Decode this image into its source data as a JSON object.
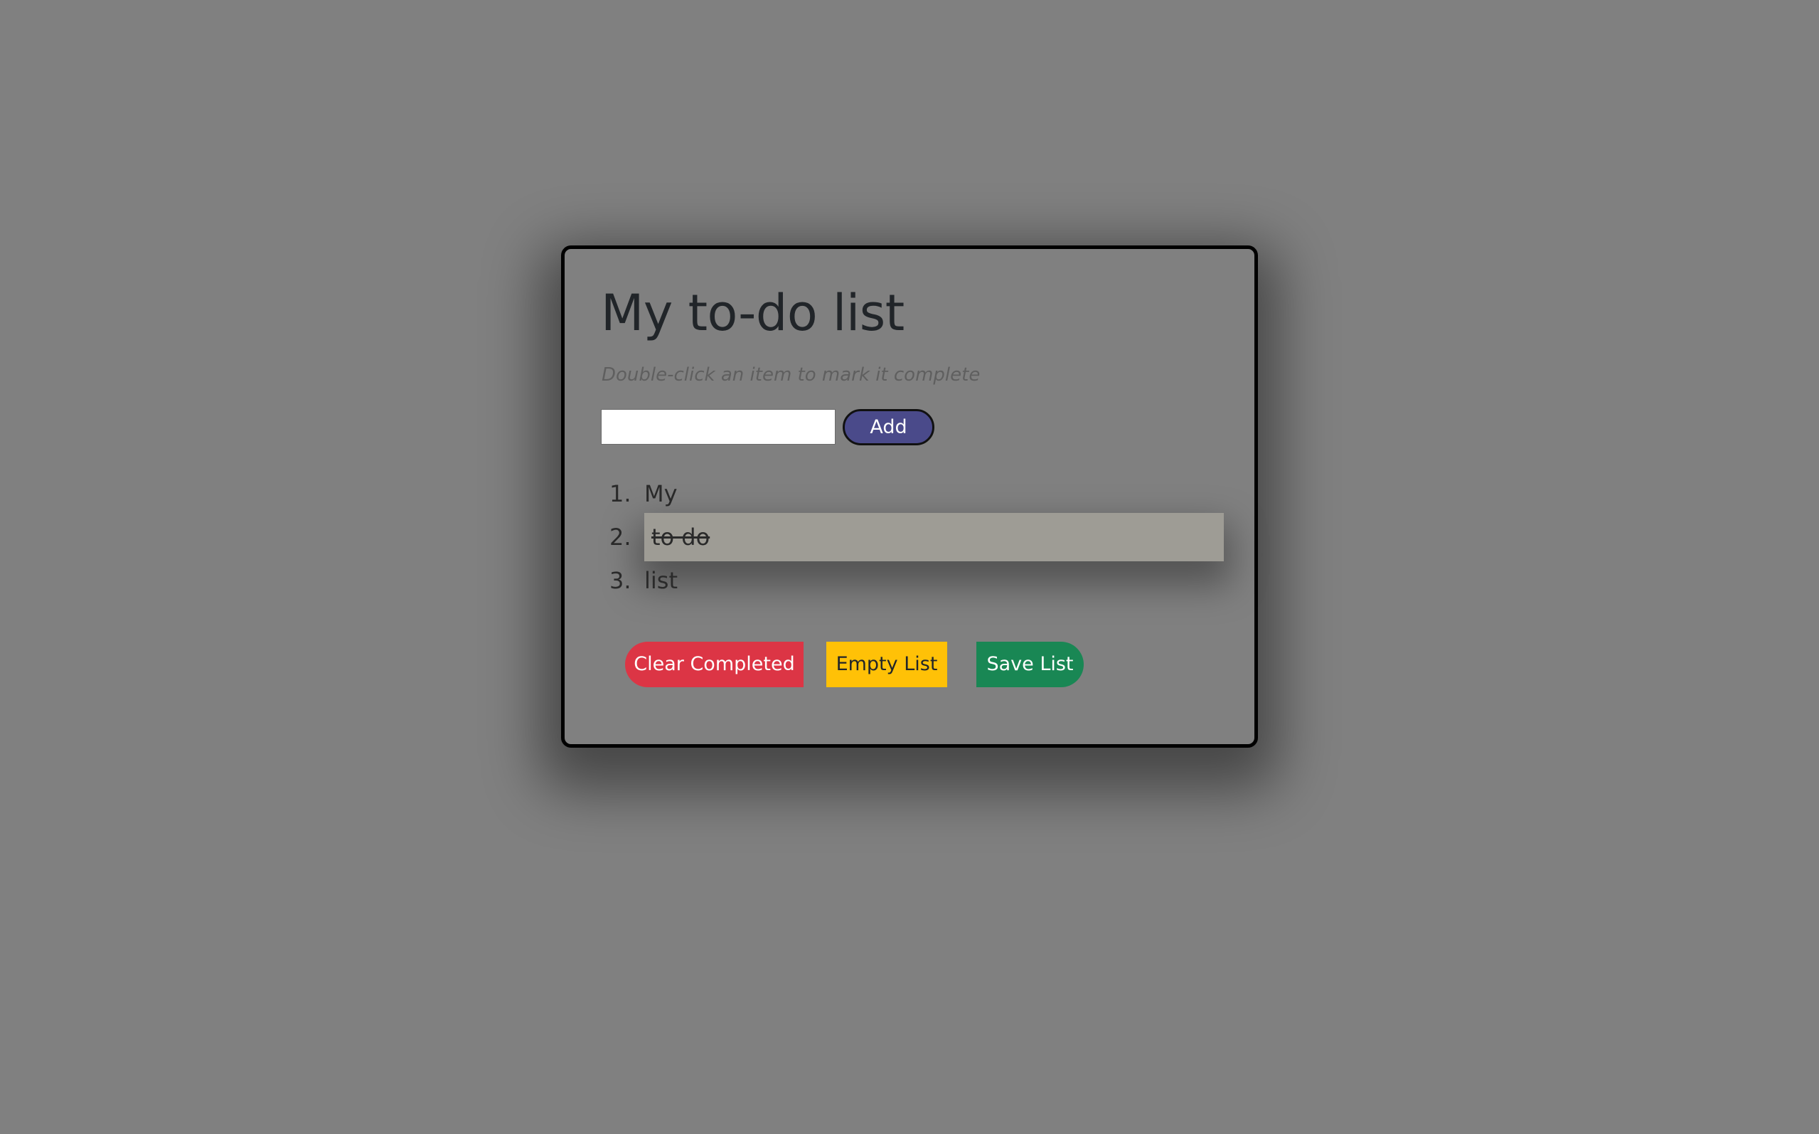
{
  "app": {
    "title": "My to-do list",
    "instructions": "Double-click an item to mark it complete"
  },
  "entry": {
    "value": "",
    "placeholder": ""
  },
  "add_button": {
    "label": "Add"
  },
  "todo_items": [
    {
      "number": "1.",
      "text": "My",
      "completed": false
    },
    {
      "number": "2.",
      "text": "to do",
      "completed": true
    },
    {
      "number": "3.",
      "text": "list",
      "completed": false
    }
  ],
  "actions": {
    "clear_completed_label": "Clear Completed",
    "empty_list_label": "Empty List",
    "save_list_label": "Save List"
  },
  "colors": {
    "background": "#808080",
    "add_button": "#4a4a8a",
    "clear_completed": "#dc3545",
    "empty_list": "#ffc107",
    "save_list": "#198754",
    "completed_item": "#9e9c95"
  }
}
